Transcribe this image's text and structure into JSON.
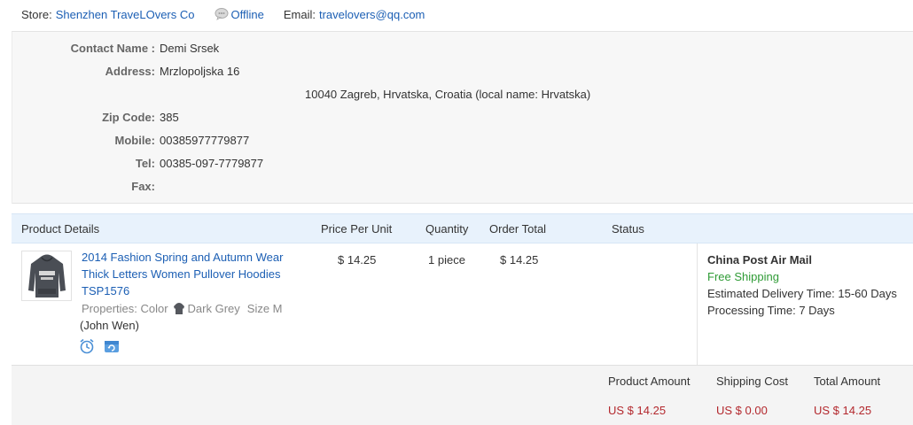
{
  "store": {
    "label": "Store:",
    "name": "Shenzhen TraveLOvers Co",
    "status": "Offline",
    "email_label": "Email:",
    "email": "travelovers@qq.com"
  },
  "address": {
    "contact_name_label": "Contact Name :",
    "contact_name": "Demi Srsek",
    "address_label": "Address:",
    "address_line1": "Mrzlopoljska 16",
    "address_line2": "10040 Zagreb, Hrvatska, Croatia (local name: Hrvatska)",
    "zip_label": "Zip Code:",
    "zip": "385",
    "mobile_label": "Mobile:",
    "mobile": "00385977779877",
    "tel_label": "Tel:",
    "tel": "00385-097-7779877",
    "fax_label": "Fax:",
    "fax": ""
  },
  "table": {
    "headers": {
      "product_details": "Product Details",
      "price_per_unit": "Price Per Unit",
      "quantity": "Quantity",
      "order_total": "Order Total",
      "status": "Status"
    },
    "item": {
      "title": "2014 Fashion Spring and Autumn Wear Thick Letters Women Pullover Hoodies TSP1576",
      "properties_label": "Properties: Color",
      "color": "Dark Grey",
      "size": "Size M",
      "buyer": "(John Wen)",
      "price": "$ 14.25",
      "quantity": "1 piece",
      "order_total": "$ 14.25",
      "status": ""
    },
    "shipping": {
      "method": "China Post Air Mail",
      "free_shipping": "Free Shipping",
      "delivery_label": "Estimated Delivery Time:",
      "delivery_time": "15-60 Days",
      "processing_label": "Processing Time:",
      "processing_time": "7 Days"
    }
  },
  "totals": {
    "product_amount_label": "Product Amount",
    "product_amount": "US $ 14.25",
    "shipping_cost_label": "Shipping Cost",
    "shipping_cost": "US $ 0.00",
    "total_amount_label": "Total Amount",
    "total_amount": "US $ 14.25"
  },
  "colors": {
    "link": "#1c5fb4",
    "price_red": "#b3282d",
    "free_green": "#2f9b36",
    "header_blue": "#e8f2fc",
    "panel_grey": "#f7f7f7"
  },
  "icons": [
    "offline-status-icon",
    "hoodie-thumbnail",
    "color-swatch-icon",
    "alarm-clock-icon",
    "refresh-icon"
  ]
}
